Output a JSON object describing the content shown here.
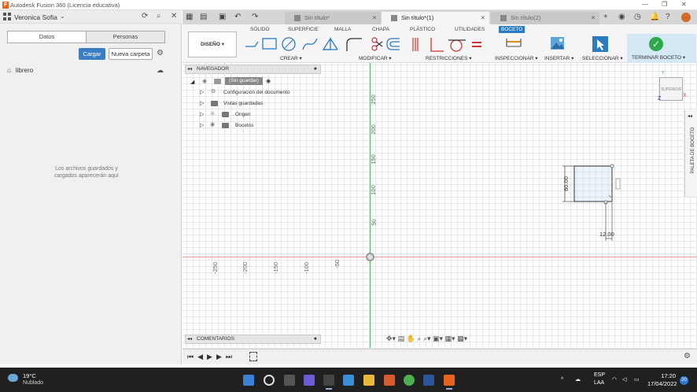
{
  "window": {
    "title": "Autodesk Fusion 360 (Licencia educativa)",
    "app_icon_letter": "F"
  },
  "leftpanel": {
    "user": "Veronica Sofia",
    "tabs": [
      "Datos",
      "Personas"
    ],
    "upload_label": "Cargar",
    "new_folder_label": "Nueva carpeta",
    "path": "librero",
    "empty_message_line1": "Los archivos guardados y",
    "empty_message_line2": "cargados aparecerán aquí"
  },
  "doc_tabs": [
    {
      "label": "Sin título*",
      "active": false
    },
    {
      "label": "Sin título*(1)",
      "active": true
    },
    {
      "label": "Sin título(2)",
      "active": false
    }
  ],
  "toolbar": {
    "workspace": "DISEÑO ▾",
    "ribbon_tabs": [
      "SÓLIDO",
      "SUPERFICIE",
      "MALLA",
      "CHAPA",
      "PLÁSTICO",
      "UTILIDADES",
      "BOCETO"
    ],
    "active_ribbon": "BOCETO",
    "groups": [
      "CREAR ▾",
      "MODIFICAR ▾",
      "RESTRICCIONES ▾",
      "INSPECCIONAR ▾",
      "INSERTAR ▾",
      "SELECCIONAR ▾"
    ],
    "finish_label": "TERMINAR BOCETO ▾"
  },
  "navigator": {
    "title": "NAVEGADOR",
    "root": "(Sin guardar)",
    "items": [
      "Configuración del documento",
      "Vistas guardadas",
      "Origen",
      "Bocetos"
    ]
  },
  "canvas": {
    "y_ticks": [
      "250",
      "200",
      "150",
      "100",
      "50"
    ],
    "x_ticks": [
      "-250",
      "-200",
      "-150",
      "-100",
      "-50"
    ],
    "dim_height": "60.00",
    "dim_width": "12.00",
    "viewcube_label": "SUPERIOR",
    "axis_x": "X",
    "axis_z": "Z",
    "axis_y": "Y",
    "palette_label": "PALETA DE BOCETO"
  },
  "comments": {
    "title": "COMENTARIOS"
  },
  "taskbar": {
    "temp": "19°C",
    "weather": "Nublado",
    "lang1": "ESP",
    "lang2": "LAA",
    "time": "17:20",
    "date": "17/04/2022",
    "notif_count": "20"
  },
  "colors": {
    "accent": "#2b7bc0",
    "finish_green": "#2da84a",
    "x_axis": "#e89c9c",
    "y_axis": "#5fc06e"
  }
}
